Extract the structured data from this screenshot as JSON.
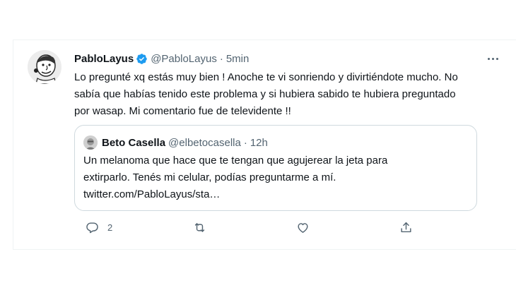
{
  "tweet": {
    "display_name": "PabloLayus",
    "handle": "@PabloLayus",
    "separator": "·",
    "time": "5min",
    "verified": true,
    "text": "Lo pregunté xq estás muy bien ! Anoche te vi sonriendo y divirtiéndote mucho. No sabía que habías tenido este problema y si hubiera sabido te hubiera preguntado por wasap. Mi comentario fue de televidente !!",
    "quote": {
      "display_name": "Beto Casella",
      "handle": "@elbetocasella",
      "separator": "·",
      "time": "12h",
      "text_line1": "Un melanoma que hace que te tengan que agujerear la jeta para",
      "text_line2": "extirparlo. Tenés mi celular, podías preguntarme a mí.",
      "text_line3": "twitter.com/PabloLayus/sta…"
    },
    "actions": {
      "reply_count": "2",
      "icons": [
        "reply-icon",
        "retweet-icon",
        "like-icon",
        "share-icon"
      ]
    }
  },
  "colors": {
    "text_primary": "#0f1419",
    "text_secondary": "#536471",
    "verified_blue": "#1d9bf0",
    "border": "#cfd9de"
  }
}
